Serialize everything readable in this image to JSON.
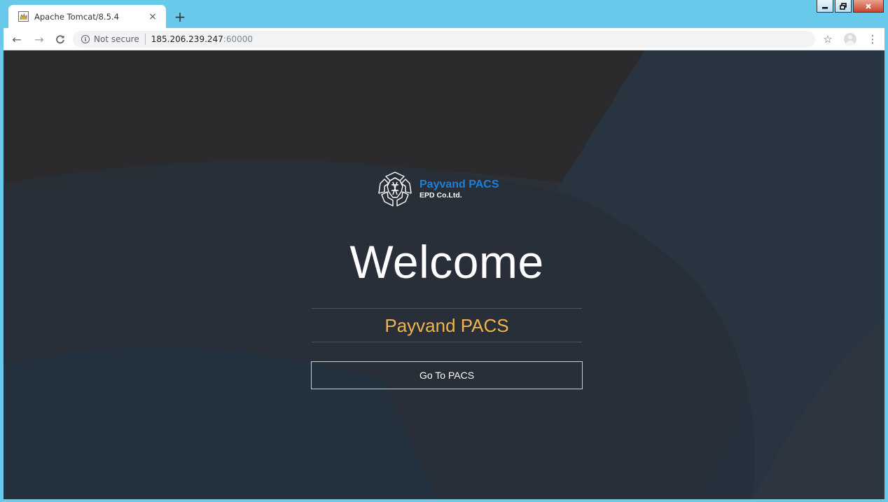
{
  "browser": {
    "tab": {
      "title": "Apache Tomcat/8.5.4",
      "close_glyph": "×",
      "favicon": "tomcat-favicon"
    },
    "new_tab_glyph": "+",
    "window_controls": {
      "minimize": "▁",
      "restore": "❐",
      "close": "✕"
    },
    "nav": {
      "back": "←",
      "forward": "→",
      "reload": "C"
    },
    "address_bar": {
      "security_icon": "info-icon",
      "security_icon_glyph": "i",
      "security_label": "Not secure",
      "url_host": "185.206.239.247",
      "url_port": ":60000"
    },
    "toolbar_right": {
      "bookmark": "☆",
      "menu": "⋮",
      "profile_icon": "profile-icon"
    },
    "colors": {
      "frame": "#69c9ea"
    }
  },
  "page": {
    "logo": {
      "name": "Payvand PACS",
      "company": "EPD Co.Ltd."
    },
    "welcome": "Welcome",
    "product": "Payvand PACS",
    "button_label": "Go To PACS",
    "colors": {
      "background": "#27313d",
      "product_text": "#f0b54a",
      "logo_name": "#1d7fd8"
    }
  }
}
